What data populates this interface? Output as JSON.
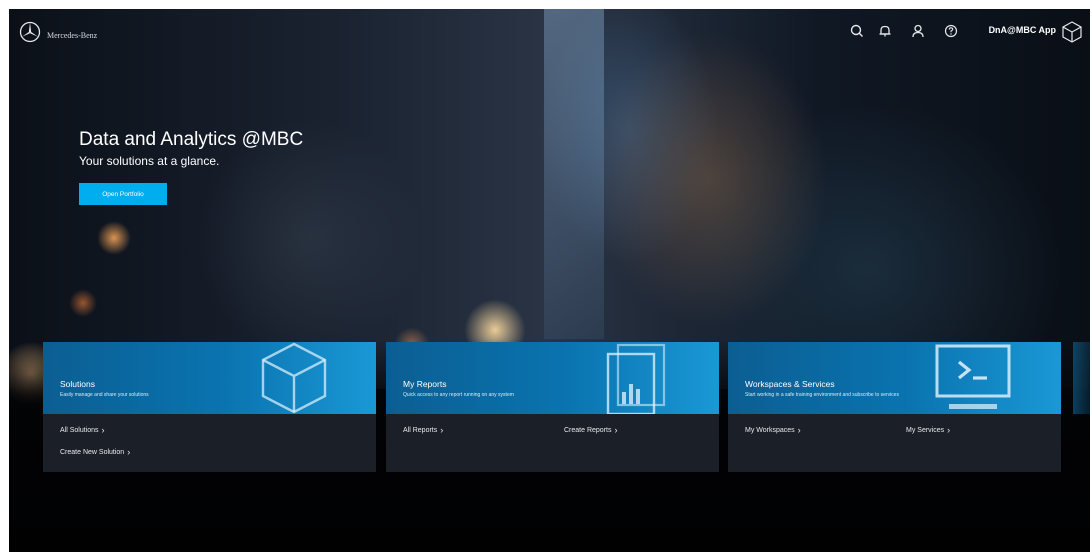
{
  "header": {
    "brand": "Mercedes-Benz",
    "app_name": "DnA@MBC App",
    "icons": [
      "search-icon",
      "bell-icon",
      "user-icon",
      "help-icon",
      "cube-icon"
    ]
  },
  "hero": {
    "title": "Data and Analytics @MBC",
    "subtitle": "Your solutions at a glance.",
    "cta_label": "Open Portfolio"
  },
  "cards": [
    {
      "title": "Solutions",
      "description": "Easily manage and share your solutions",
      "links": [
        "All Solutions",
        "Create New Solution"
      ],
      "art": "cube-icon"
    },
    {
      "title": "My Reports",
      "description": "Quick access to any report running on any system",
      "links": [
        "All Reports",
        "Create Reports"
      ],
      "art": "report-chart-icon"
    },
    {
      "title": "Workspaces & Services",
      "description": "Start working in a safe training environment and subscribe to services",
      "links": [
        "My Workspaces",
        "My Services"
      ],
      "art": "terminal-icon"
    }
  ],
  "colors": {
    "accent": "#00adef",
    "card_blue": "#0a74b0",
    "card_dark": "#1b1f27"
  }
}
